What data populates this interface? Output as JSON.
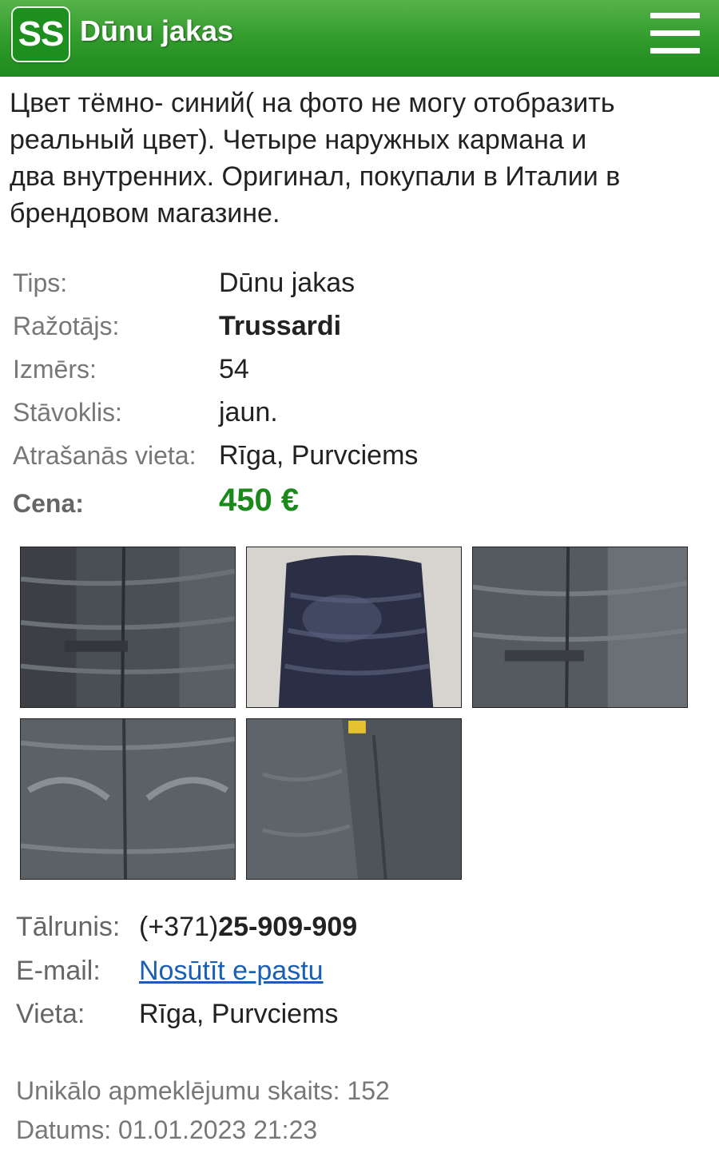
{
  "header": {
    "logo_text": "SS",
    "title": "Dūnu jakas",
    "menu_icon": "hamburger-menu-icon"
  },
  "description": {
    "lines": [
      "Цвет тёмно- синий( на фото не могу отобразить",
      "реальный цвет). Четыре наружных кармана и",
      "два внутренних. Оригинал, покупали в Италии в",
      "брендовом магазине."
    ]
  },
  "options": {
    "type_label": "Tips:",
    "type_value": "Dūnu jakas",
    "maker_label": "Ražotājs:",
    "maker_value": "Trussardi",
    "size_label": "Izmērs:",
    "size_value": "54",
    "condition_label": "Stāvoklis:",
    "condition_value": "jaun.",
    "location_label": "Atrašanās vieta:",
    "location_value": "Rīga, Purvciems",
    "price_label": "Cena:",
    "price_value": "450 €"
  },
  "contacts": {
    "phone_label": "Tālrunis:",
    "phone_prefix": "(+371)",
    "phone_number": "25-909-909",
    "email_label": "E-mail:",
    "email_link": "Nosūtīt e-pastu",
    "place_label": "Vieta:",
    "place_value": "Rīga, Purvciems"
  },
  "footer": {
    "visits": "Unikālo apmeklējumu skaits: 152",
    "date": "Datums: 01.01.2023 21:23"
  },
  "colors": {
    "header_green": "#2f9a2a",
    "price_green": "#1a8a1a",
    "link_blue": "#1a5fb4"
  }
}
